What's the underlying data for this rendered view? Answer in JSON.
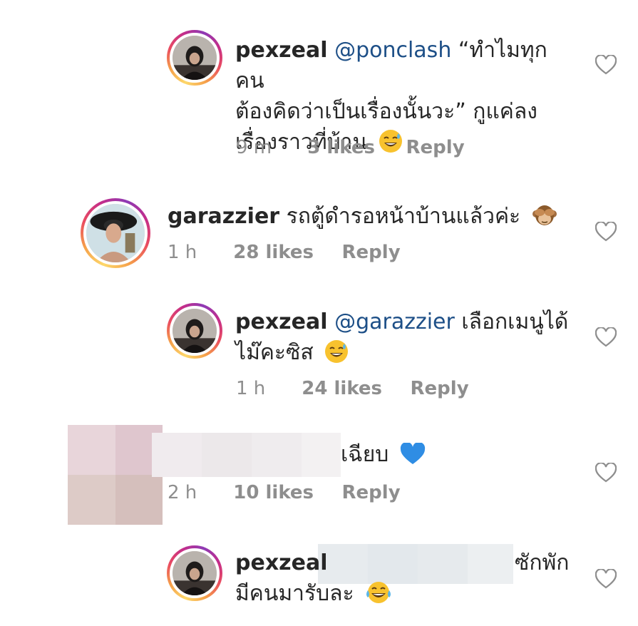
{
  "comments": [
    {
      "username": "pexzeal",
      "mention": "@ponclash",
      "text_line1": " “ทำไมทุกคน",
      "text_line2": "ต้องคิดว่าเป็นเรื่องนั้นวะ” กูแค่ลง",
      "text_line3": "เรื่องราวที่บ้าน",
      "emoji": "sweat-smile-emoji",
      "time": "9 m",
      "likes": "3 likes",
      "reply": "Reply"
    },
    {
      "username": "garazzier",
      "text_line1": " รถตู้ดำรอหน้าบ้านแล้วค่ะ",
      "emoji": "see-no-evil-monkey-emoji",
      "time": "1 h",
      "likes": "28 likes",
      "reply": "Reply"
    },
    {
      "username": "pexzeal",
      "mention": "@garazzier",
      "text_line1": " เลือกเมนูได้",
      "text_line2": "ไม๊คะซิส",
      "emoji": "sweat-smile-emoji",
      "time": "1 h",
      "likes": "24 likes",
      "reply": "Reply"
    },
    {
      "text_line1": "เฉียบ",
      "emoji": "blue-heart-emoji",
      "time": "2 h",
      "likes": "10 likes",
      "reply": "Reply"
    },
    {
      "username": "pexzeal",
      "text_line1": "ซักพัก",
      "text_line2": "มีคนมารับละ",
      "emoji": "tears-of-joy-emoji"
    }
  ],
  "icons": {
    "like": "heart-outline-icon"
  },
  "colors": {
    "username": "#262626",
    "mention": "#1d4f87",
    "meta": "#8e8e8e",
    "heart": "#8e8e8e"
  }
}
